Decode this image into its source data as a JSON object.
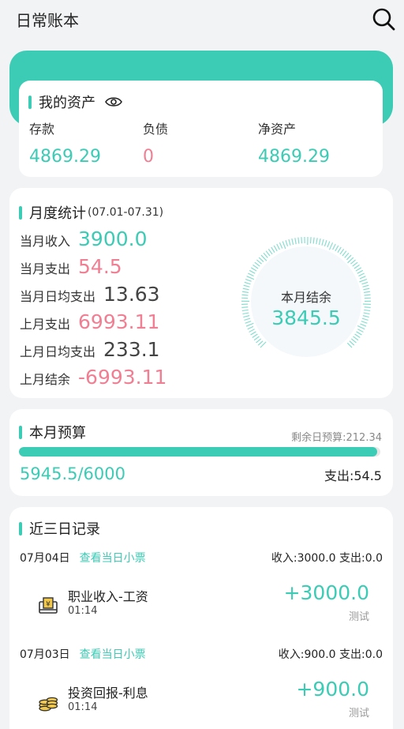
{
  "header": {
    "title": "日常账本",
    "search_icon": "search-icon"
  },
  "assets": {
    "title": "我的资产",
    "eye_icon": "eye-icon",
    "deposit_label": "存款",
    "deposit": "4869.29",
    "debt_label": "负债",
    "debt": "0",
    "net_label": "净资产",
    "net": "4869.29"
  },
  "monthly": {
    "title": "月度统计",
    "range": "(07.01-07.31)",
    "rows": [
      {
        "label": "当月收入",
        "value": "3900.0",
        "color": "#3ccbb5"
      },
      {
        "label": "当月支出",
        "value": "54.5",
        "color": "#f07f93"
      },
      {
        "label": "当月日均支出",
        "value": "13.63",
        "color": "#444444"
      },
      {
        "label": "上月支出",
        "value": "6993.11",
        "color": "#f07f93"
      },
      {
        "label": "上月日均支出",
        "value": "233.1",
        "color": "#444444"
      },
      {
        "label": "上月结余",
        "value": "-6993.11",
        "color": "#f07f93"
      }
    ],
    "gauge_label": "本月结余",
    "gauge_value": "3845.5"
  },
  "budget": {
    "title": "本月预算",
    "remaining": "剩余日预算:212.34",
    "progress_fraction": 0.991,
    "value": "5945.5/6000",
    "spent": "支出:54.5"
  },
  "records": {
    "title": "近三日记录",
    "days": [
      {
        "date": "07月04日",
        "link": "查看当日小票",
        "summary": "收入:3000.0  支出:0.0",
        "items": [
          {
            "icon": "salary-icon",
            "name": "职业收入-工资",
            "time": "01:14",
            "amount": "+3000.0",
            "note": "测试"
          }
        ]
      },
      {
        "date": "07月03日",
        "link": "查看当日小票",
        "summary": "收入:900.0  支出:0.0",
        "items": [
          {
            "icon": "coins-icon",
            "name": "投资回报-利息",
            "time": "01:14",
            "amount": "+900.0",
            "note": "测试"
          }
        ]
      }
    ]
  },
  "colors": {
    "accent": "#3ccbb5",
    "expense": "#f07f93",
    "background": "#f2f3f5"
  }
}
